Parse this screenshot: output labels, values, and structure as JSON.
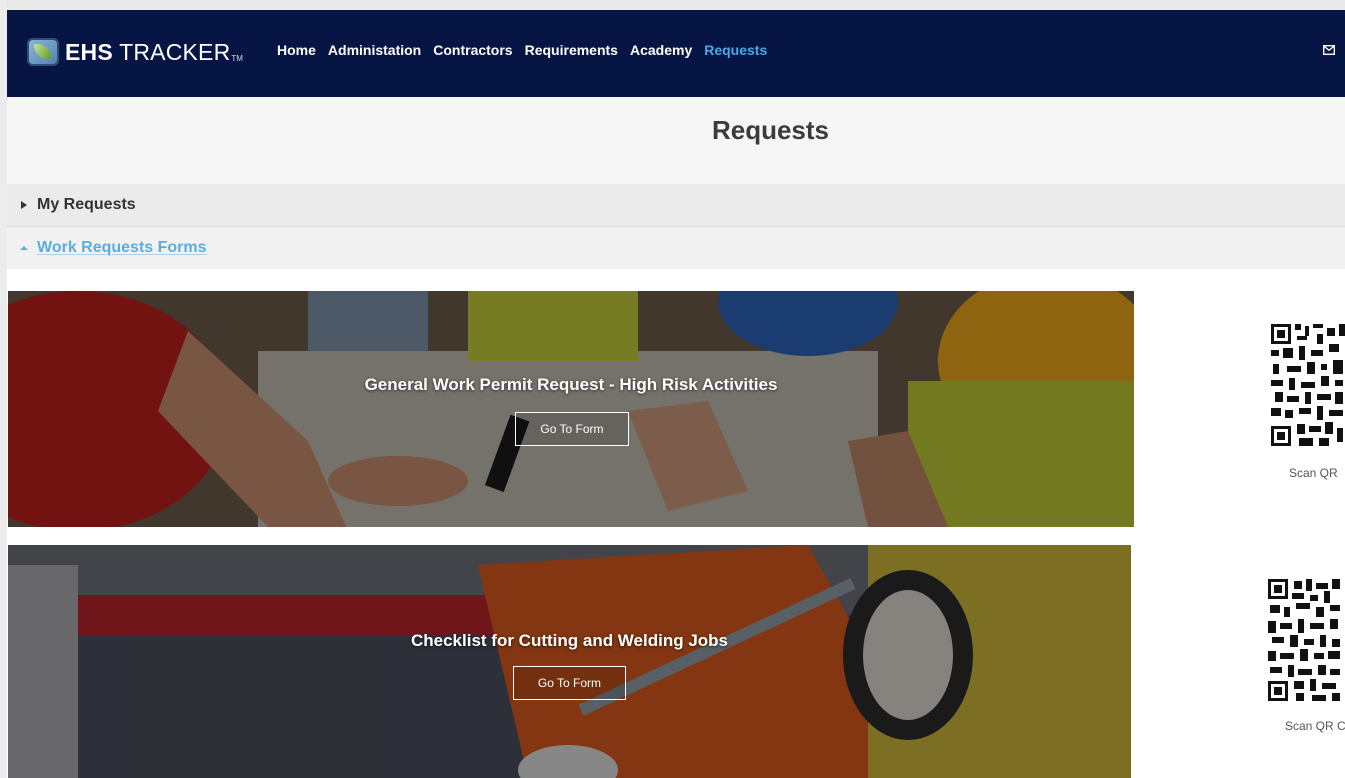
{
  "app": {
    "logo_bold": "EHS",
    "logo_light": "TRACKER",
    "logo_tm": "TM"
  },
  "nav": {
    "items": [
      {
        "label": "Home"
      },
      {
        "label": "Administation"
      },
      {
        "label": "Contractors"
      },
      {
        "label": "Requirements"
      },
      {
        "label": "Academy"
      },
      {
        "label": "Requests"
      }
    ],
    "active": "Requests"
  },
  "header_icons": {
    "mail": "mail-icon"
  },
  "page": {
    "title": "Requests"
  },
  "sections": [
    {
      "label": "My Requests",
      "state": "collapsed",
      "icon": "caret-right-icon"
    },
    {
      "label": "Work Requests Forms",
      "state": "expanded",
      "icon": "caret-up-icon"
    }
  ],
  "forms": [
    {
      "title": "General Work Permit Request - High Risk Activities",
      "button": "Go To Form",
      "qr_label": "Scan QR"
    },
    {
      "title": "Checklist for Cutting and Welding Jobs",
      "button": "Go To Form",
      "qr_label": "Scan QR C"
    }
  ],
  "colors": {
    "header_bg": "#071544",
    "nav_active": "#4aa8e8",
    "section_link": "#5aaede"
  }
}
